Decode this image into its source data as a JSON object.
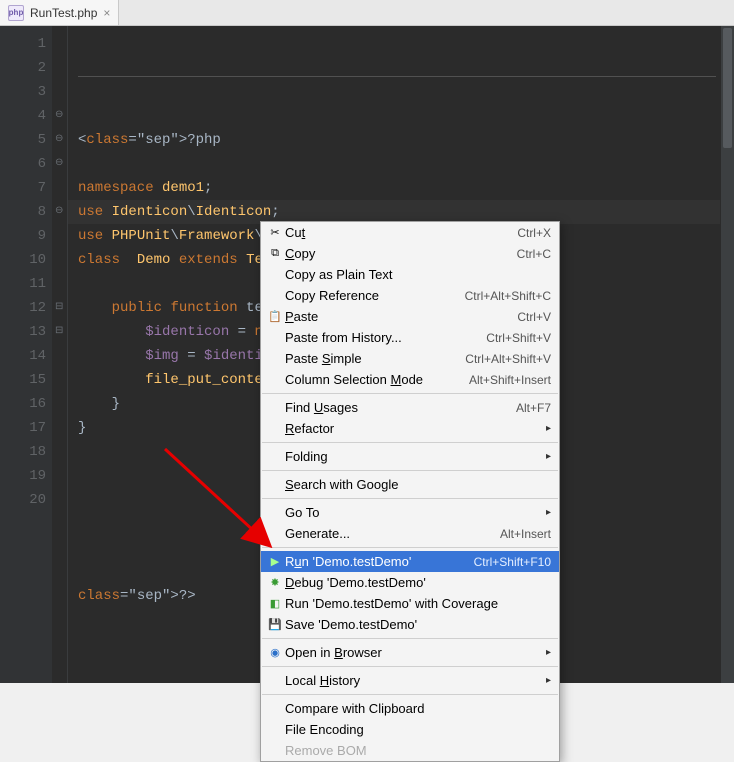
{
  "tab": {
    "filename": "RunTest.php",
    "icon": "php-file-icon"
  },
  "editor": {
    "lines": [
      "<?php",
      "",
      "namespace demo1;",
      "use Identicon\\Identicon;",
      "use PHPUnit\\Framework\\TestCase;",
      "class  Demo extends TestCase{",
      "",
      "    public function testD",
      "        $identicon = new ",
      "        $img = $identico",
      "        file_put_contents",
      "    }",
      "}",
      "",
      "",
      "",
      "",
      "",
      "",
      "?>"
    ],
    "line_count": 20
  },
  "menu": {
    "items": [
      {
        "icon": "scissors-icon",
        "label": "Cut",
        "u": "t",
        "shortcut": "Ctrl+X"
      },
      {
        "icon": "copy-icon",
        "label": "Copy",
        "u": "C",
        "shortcut": "Ctrl+C"
      },
      {
        "label": "Copy as Plain Text"
      },
      {
        "label": "Copy Reference",
        "shortcut": "Ctrl+Alt+Shift+C"
      },
      {
        "icon": "paste-icon",
        "label": "Paste",
        "u": "P",
        "shortcut": "Ctrl+V"
      },
      {
        "label": "Paste from History...",
        "shortcut": "Ctrl+Shift+V"
      },
      {
        "label": "Paste Simple",
        "u": "S",
        "shortcut": "Ctrl+Alt+Shift+V"
      },
      {
        "label": "Column Selection Mode",
        "u": "M",
        "shortcut": "Alt+Shift+Insert"
      },
      {
        "sep": true
      },
      {
        "label": "Find Usages",
        "u": "U",
        "shortcut": "Alt+F7"
      },
      {
        "label": "Refactor",
        "u": "R",
        "submenu": true
      },
      {
        "sep": true
      },
      {
        "label": "Folding",
        "submenu": true
      },
      {
        "sep": true
      },
      {
        "label": "Search with Google",
        "u": "S"
      },
      {
        "sep": true
      },
      {
        "label": "Go To",
        "submenu": true
      },
      {
        "label": "Generate...",
        "shortcut": "Alt+Insert"
      },
      {
        "sep": true
      },
      {
        "icon": "run-icon",
        "label": "Run 'Demo.testDemo'",
        "u": "u",
        "shortcut": "Ctrl+Shift+F10",
        "selected": true
      },
      {
        "icon": "debug-icon",
        "label": "Debug 'Demo.testDemo'",
        "u": "D"
      },
      {
        "icon": "coverage-icon",
        "label": "Run 'Demo.testDemo' with Coverage"
      },
      {
        "icon": "save-icon",
        "label": "Save 'Demo.testDemo'"
      },
      {
        "sep": true
      },
      {
        "icon": "browser-icon",
        "label": "Open in Browser",
        "u": "B",
        "submenu": true
      },
      {
        "sep": true
      },
      {
        "label": "Local History",
        "u": "H",
        "submenu": true
      },
      {
        "sep": true
      },
      {
        "label": "Compare with Clipboard"
      },
      {
        "label": "File Encoding"
      },
      {
        "label": "Remove BOM",
        "faded": true
      }
    ]
  },
  "annotation": {
    "arrow_color": "#e60000"
  }
}
